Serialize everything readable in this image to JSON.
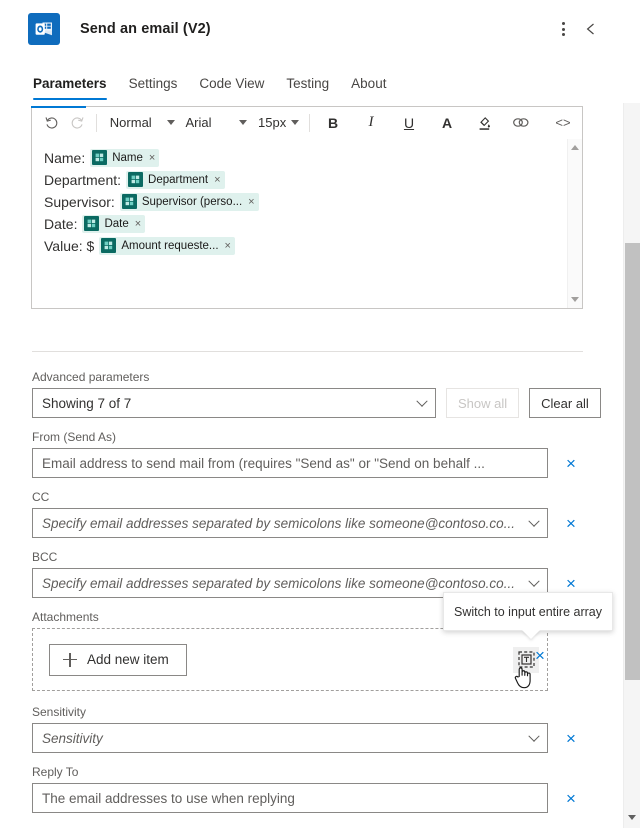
{
  "header": {
    "title": "Send an email (V2)",
    "icon": "outlook-icon",
    "more_label": "⋮",
    "collapse_label": "‹"
  },
  "tabs": [
    {
      "label": "Parameters",
      "active": true
    },
    {
      "label": "Settings",
      "active": false
    },
    {
      "label": "Code View",
      "active": false
    },
    {
      "label": "Testing",
      "active": false
    },
    {
      "label": "About",
      "active": false
    }
  ],
  "editor": {
    "toolbar": {
      "undo": "↺",
      "redo": "↻",
      "style": "Normal",
      "font": "Arial",
      "size": "15px",
      "bold": "B",
      "italic": "I",
      "underline": "U",
      "font_color": "A",
      "highlight": "highlight-icon",
      "link": "link-icon",
      "code": "<>"
    },
    "lines": [
      {
        "label": "Name:",
        "token": "Name"
      },
      {
        "label": "Department:",
        "token": "Department"
      },
      {
        "label": "Supervisor:",
        "token": "Supervisor (perso..."
      },
      {
        "label": "Date:",
        "token": "Date"
      },
      {
        "label": "Value: $",
        "token": "Amount requeste..."
      }
    ],
    "token_remove": "×"
  },
  "advanced": {
    "label": "Advanced parameters",
    "selected": "Showing 7 of 7",
    "show_all": "Show all",
    "clear_all": "Clear all"
  },
  "fields": [
    {
      "label": "From (Send As)",
      "placeholder": "Email address to send mail from (requires \"Send as\" or \"Send on behalf ...",
      "type": "text",
      "italic": false
    },
    {
      "label": "CC",
      "placeholder": "Specify email addresses separated by semicolons like someone@contoso.co...",
      "type": "select",
      "italic": true
    },
    {
      "label": "BCC",
      "placeholder": "Specify email addresses separated by semicolons like someone@contoso.co...",
      "type": "select",
      "italic": true
    }
  ],
  "attachments": {
    "label": "Attachments",
    "add_label": "Add new item",
    "array_icon": "switch-to-array-icon",
    "remove_label": "×"
  },
  "tooltip": {
    "text": "Switch to input entire array"
  },
  "lower_fields": [
    {
      "label": "Sensitivity",
      "placeholder": "Sensitivity",
      "type": "select",
      "italic": true
    },
    {
      "label": "Reply To",
      "placeholder": "The email addresses to use when replying",
      "type": "text",
      "italic": false
    }
  ],
  "remove_label": "×",
  "colors": {
    "accent": "#0078d4",
    "brand": "#0f6cbd",
    "token_bg": "#dff1ed",
    "token_icon": "#0b6a62",
    "border": "#8a8886"
  }
}
